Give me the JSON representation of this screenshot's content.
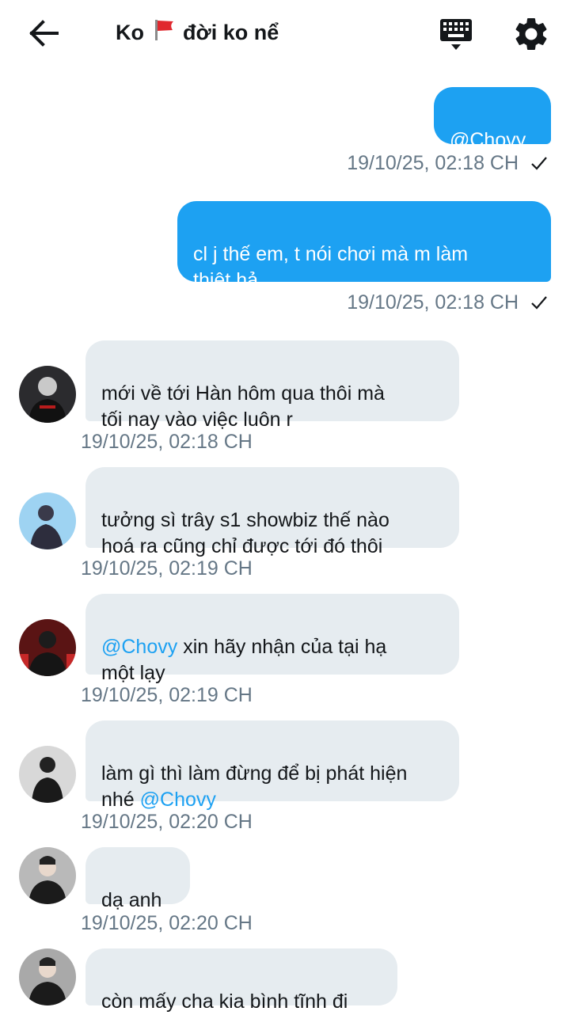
{
  "header": {
    "title_left": "Ko",
    "title_right": "đời ko nể",
    "flag_icon": "red-flag-icon",
    "back_icon": "arrow-left-icon",
    "keyboard_icon": "keyboard-icon",
    "settings_icon": "gear-icon"
  },
  "colors": {
    "accent": "#1da1f2",
    "incoming_bubble": "#e6ecf0",
    "timestamp": "#657786"
  },
  "messages": [
    {
      "dir": "out",
      "text": "@Chovy",
      "time": "19/10/25, 02:18 CH",
      "read": true
    },
    {
      "dir": "out",
      "text": "cl j thế em, t nói chơi mà m làm\nthiệt hả",
      "time": "19/10/25, 02:18 CH",
      "read": true
    },
    {
      "dir": "in",
      "text": "mới về tới Hàn hôm qua thôi mà\ntối nay vào việc luôn r",
      "time": "19/10/25, 02:18 CH"
    },
    {
      "dir": "in",
      "text": "tưởng sì trây s1 showbiz thế nào\nhoá ra cũng chỉ được tới đó thôi",
      "time": "19/10/25, 02:19 CH"
    },
    {
      "dir": "in",
      "mention": "@Chovy",
      "text": " xin hãy nhận của tại hạ\nmột lạy",
      "time": "19/10/25, 02:19 CH"
    },
    {
      "dir": "in",
      "text": "làm gì thì làm đừng để bị phát hiện\nnhé ",
      "mention": "@Chovy",
      "time": "19/10/25, 02:20 CH"
    },
    {
      "dir": "in",
      "text": "dạ anh",
      "time": "19/10/25, 02:20 CH"
    },
    {
      "dir": "in",
      "text": "còn mấy cha kia bình tĩnh đi",
      "time": ""
    }
  ]
}
